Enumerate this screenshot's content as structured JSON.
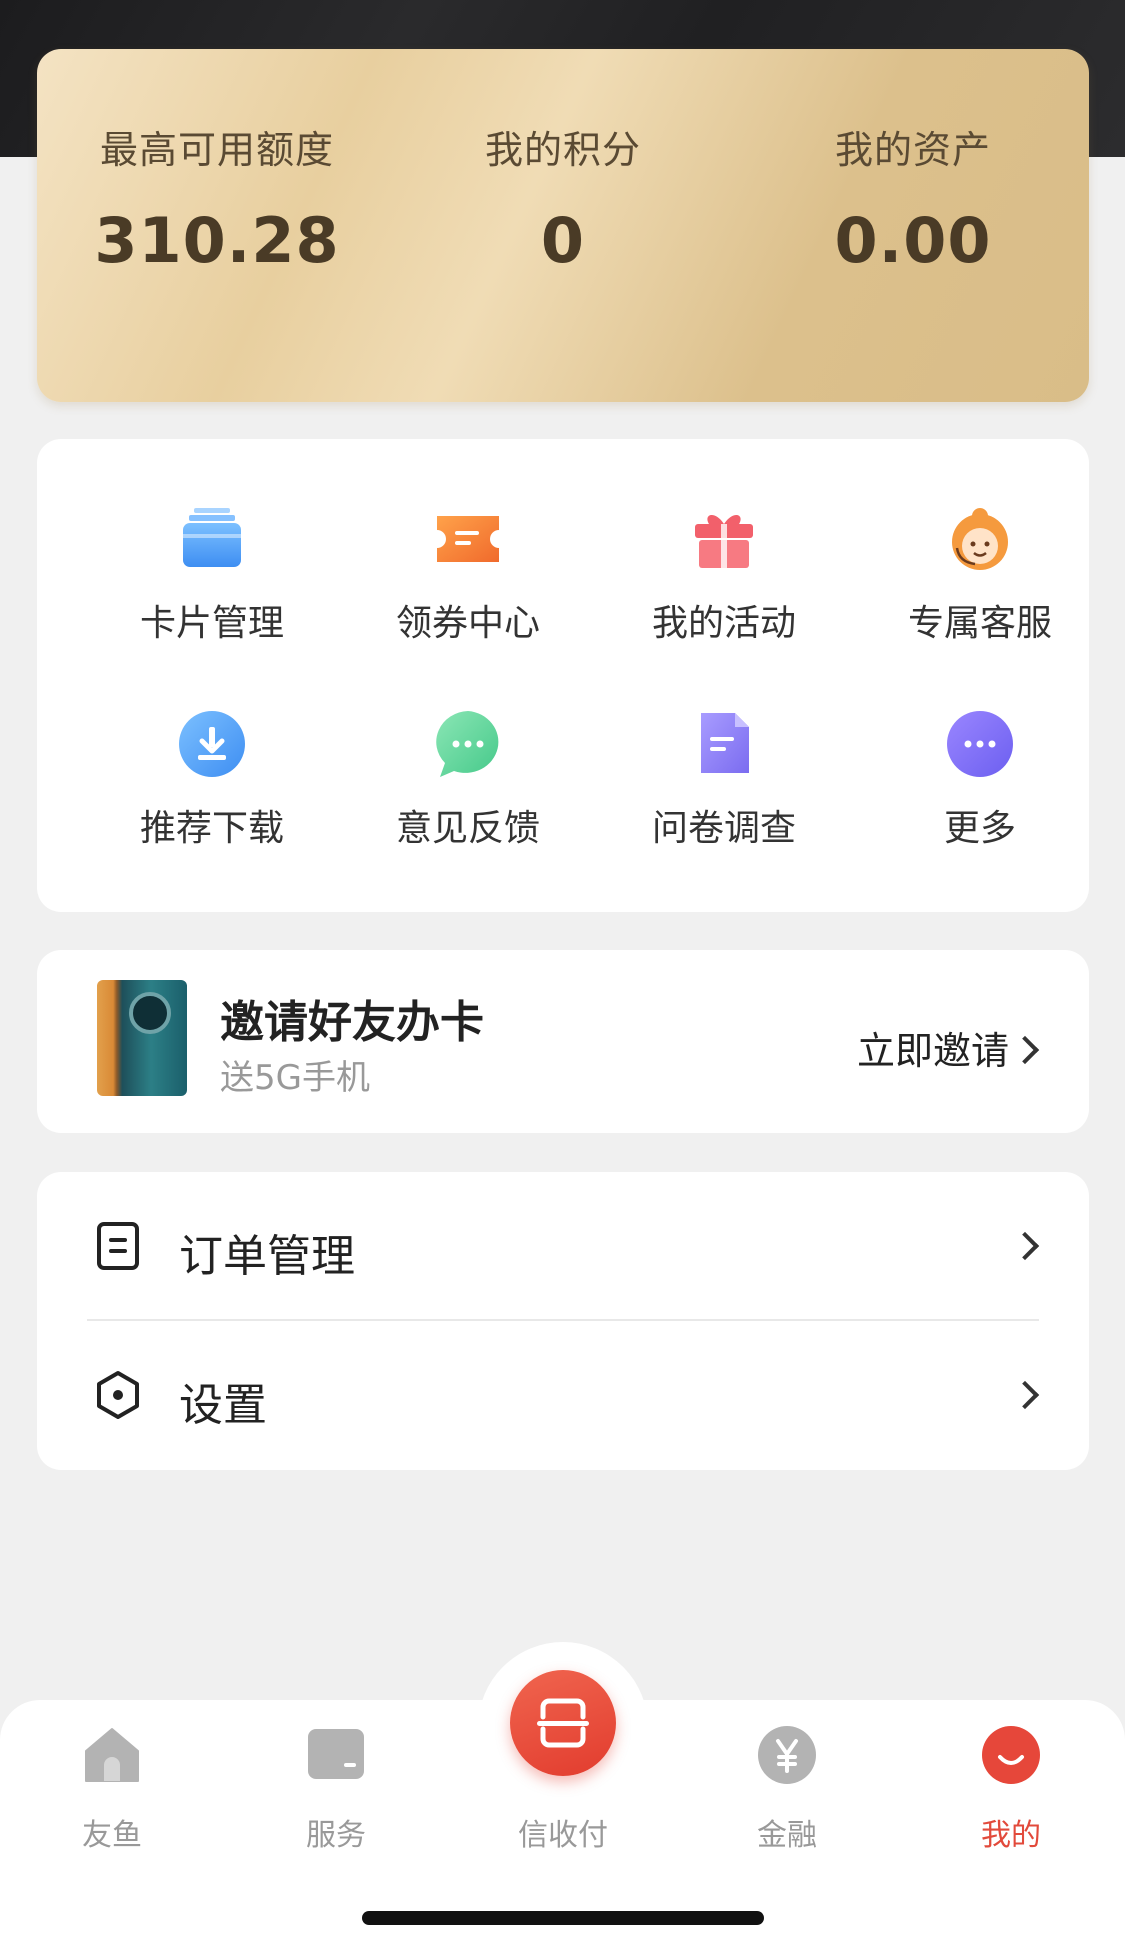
{
  "summary": {
    "items": [
      {
        "label": "最高可用额度",
        "value": "310.28"
      },
      {
        "label": "我的积分",
        "value": "0"
      },
      {
        "label": "我的资产",
        "value": "0.00"
      }
    ]
  },
  "services": {
    "items": [
      {
        "label": "卡片管理",
        "icon": "cards-icon"
      },
      {
        "label": "领券中心",
        "icon": "coupon-icon"
      },
      {
        "label": "我的活动",
        "icon": "gift-icon"
      },
      {
        "label": "专属客服",
        "icon": "customer-service-icon"
      },
      {
        "label": "推荐下载",
        "icon": "download-icon"
      },
      {
        "label": "意见反馈",
        "icon": "feedback-icon"
      },
      {
        "label": "问卷调查",
        "icon": "survey-icon"
      },
      {
        "label": "更多",
        "icon": "more-icon"
      }
    ]
  },
  "invite": {
    "title": "邀请好友办卡",
    "subtitle": "送5G手机",
    "action": "立即邀请"
  },
  "menu": {
    "items": [
      {
        "label": "订单管理",
        "icon": "order-icon"
      },
      {
        "label": "设置",
        "icon": "settings-icon"
      }
    ]
  },
  "tabbar": {
    "items": [
      {
        "label": "友鱼",
        "icon": "home-icon"
      },
      {
        "label": "服务",
        "icon": "service-icon"
      },
      {
        "label": "信收付",
        "icon": "scan-icon"
      },
      {
        "label": "金融",
        "icon": "yen-icon"
      },
      {
        "label": "我的",
        "icon": "profile-icon"
      }
    ],
    "active_index": 4
  },
  "colors": {
    "accent": "#e24a3b",
    "card_gold": "#e8cf9f"
  }
}
